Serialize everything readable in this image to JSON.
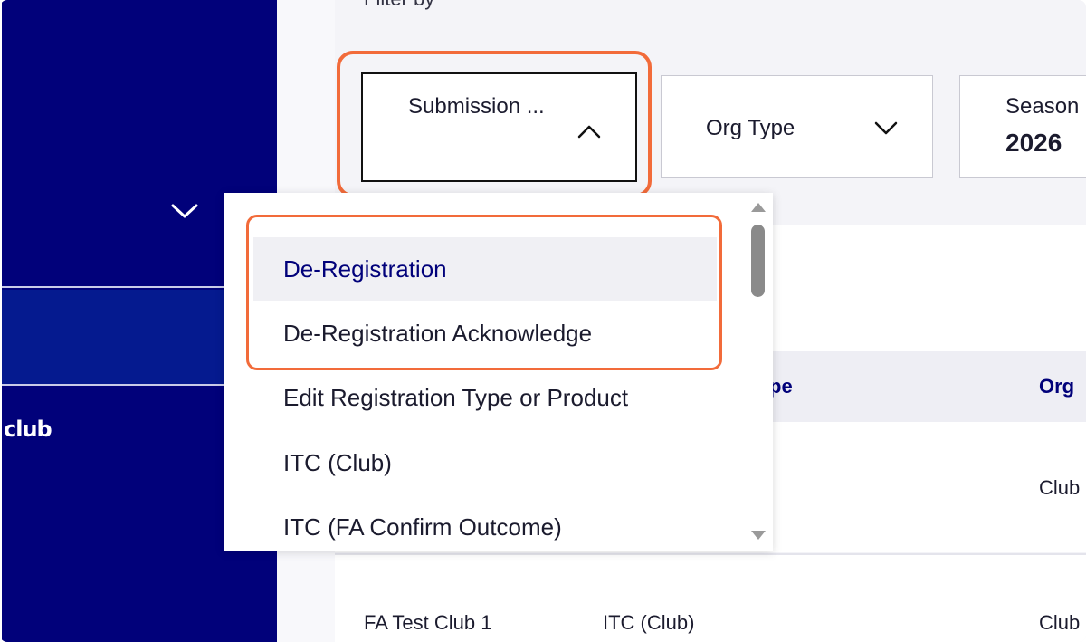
{
  "filter": {
    "label": "Filter by",
    "submission_type": {
      "label": "Submission ...",
      "state": "open"
    },
    "org_type": {
      "label": "Org Type"
    },
    "season": {
      "label": "Season",
      "value": "2026"
    }
  },
  "sidebar": {
    "club_label": "club"
  },
  "dropdown": {
    "options": [
      "De-Registration",
      "De-Registration Acknowledge",
      "Edit Registration Type or Product",
      "ITC (Club)",
      "ITC (FA Confirm Outcome)"
    ],
    "hovered_index": 0
  },
  "table": {
    "headers": {
      "type_partial": "pe",
      "org_partial": "Org"
    },
    "rows": [
      {
        "club": "",
        "type": "",
        "org": "Club"
      },
      {
        "club": "FA Test Club 1",
        "type": "ITC (Club)",
        "org": "Club"
      }
    ]
  },
  "colors": {
    "sidebar": "#01017a",
    "highlight": "#f26b3a",
    "accent_text": "#01017a"
  }
}
